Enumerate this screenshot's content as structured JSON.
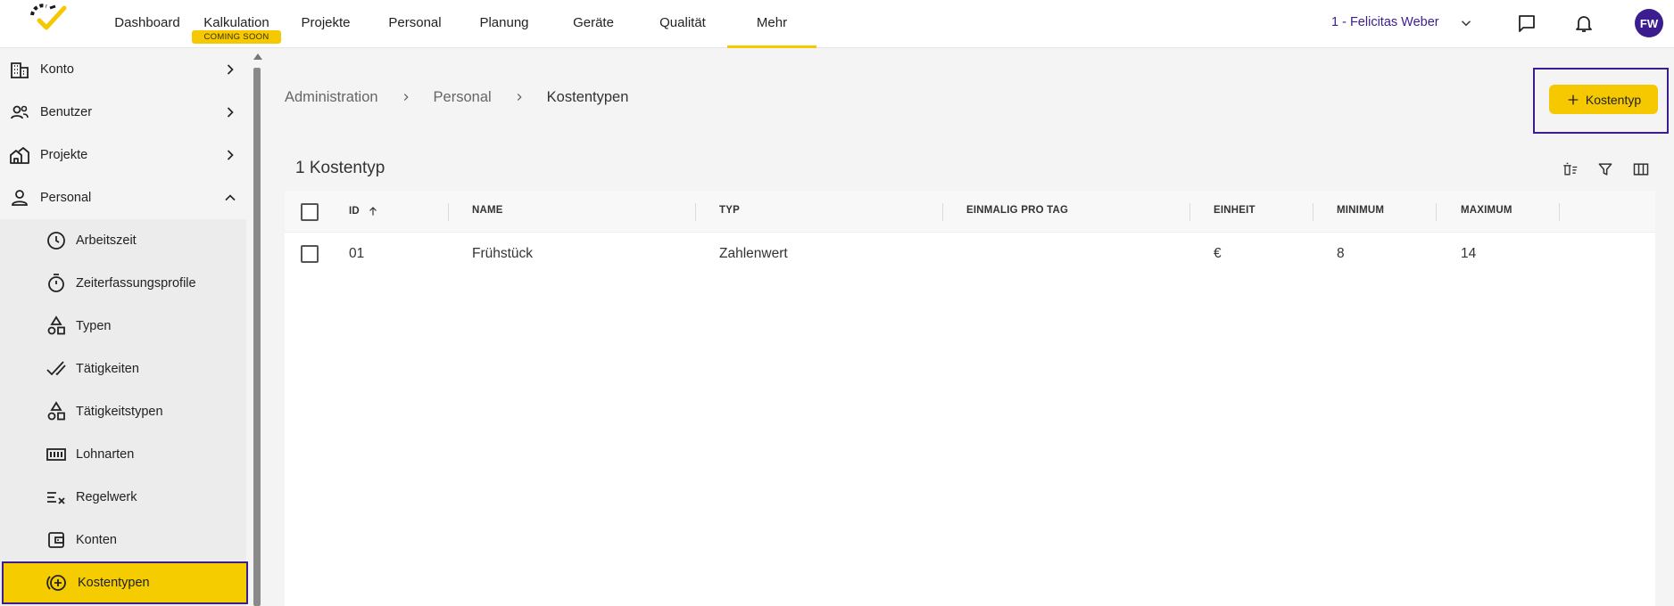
{
  "topnav": {
    "items": [
      "Dashboard",
      "Kalkulation",
      "Projekte",
      "Personal",
      "Planung",
      "Geräte",
      "Qualität",
      "Mehr"
    ],
    "badge": "COMING SOON",
    "tenant": "1 - Felicitas Weber",
    "avatar_initials": "FW",
    "accent": "#f5c800",
    "brand": "#3b1d8f"
  },
  "sidebar": {
    "items": [
      {
        "label": "Konto",
        "icon": "building-icon"
      },
      {
        "label": "Benutzer",
        "icon": "users-icon"
      },
      {
        "label": "Projekte",
        "icon": "houses-icon"
      },
      {
        "label": "Personal",
        "icon": "person-icon"
      }
    ],
    "subitems": [
      {
        "label": "Arbeitszeit",
        "icon": "clock-icon"
      },
      {
        "label": "Zeiterfassungsprofile",
        "icon": "stopwatch-icon"
      },
      {
        "label": "Typen",
        "icon": "shapes-icon"
      },
      {
        "label": "Tätigkeiten",
        "icon": "double-check-icon"
      },
      {
        "label": "Tätigkeitstypen",
        "icon": "shapes-icon"
      },
      {
        "label": "Lohnarten",
        "icon": "counter-icon"
      },
      {
        "label": "Regelwerk",
        "icon": "rules-icon"
      },
      {
        "label": "Konten",
        "icon": "wallet-icon"
      },
      {
        "label": "Kostentypen",
        "icon": "cost-add-icon"
      }
    ]
  },
  "breadcrumb": [
    "Administration",
    "Personal",
    "Kostentypen"
  ],
  "add_button": "Kostentyp",
  "count_title": "1 Kostentyp",
  "table": {
    "columns": [
      "ID",
      "NAME",
      "TYP",
      "EINMALIG PRO TAG",
      "EINHEIT",
      "MINIMUM",
      "MAXIMUM"
    ],
    "rows": [
      {
        "id": "01",
        "name": "Frühstück",
        "typ": "Zahlenwert",
        "einmalig": "",
        "einheit": "€",
        "minimum": "8",
        "maximum": "14"
      }
    ]
  }
}
